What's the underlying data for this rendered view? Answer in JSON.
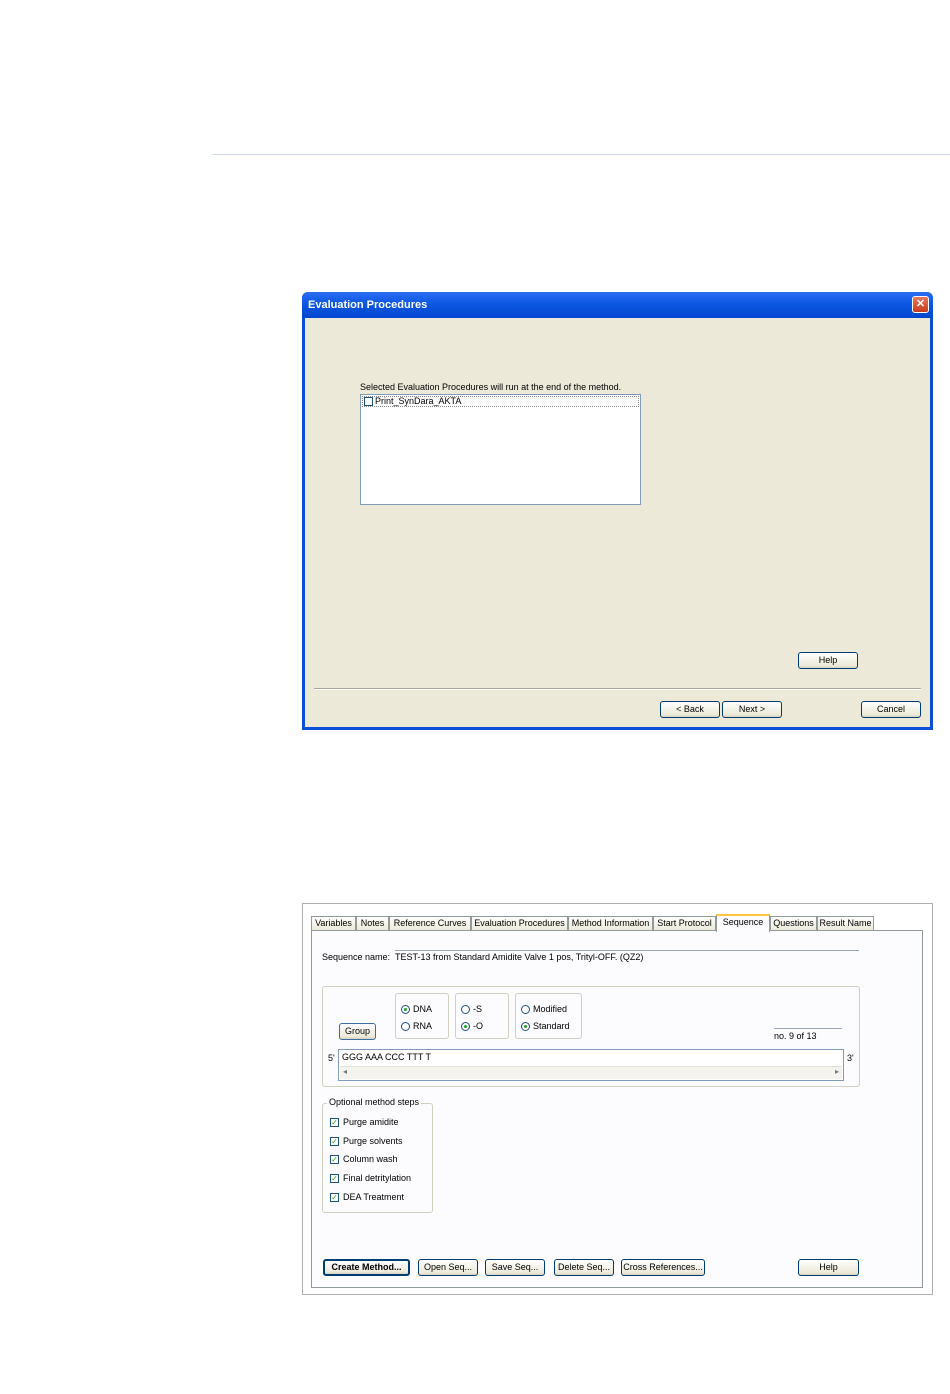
{
  "dialog": {
    "title": "Evaluation Procedures",
    "close_glyph": "✕",
    "instruction": "Selected Evaluation Procedures will run at the end of the method.",
    "procedures": [
      {
        "label": "Print_SynDara_AKTA",
        "checked": false
      }
    ],
    "help_label": "Help",
    "back_label": "< Back",
    "next_label": "Next >",
    "cancel_label": "Cancel"
  },
  "method_editor": {
    "tabs": [
      {
        "label": "Variables",
        "active": false
      },
      {
        "label": "Notes",
        "active": false
      },
      {
        "label": "Reference Curves",
        "active": false
      },
      {
        "label": "Evaluation Procedures",
        "active": false
      },
      {
        "label": "Method Information",
        "active": false
      },
      {
        "label": "Start Protocol",
        "active": false
      },
      {
        "label": "Sequence",
        "active": true
      },
      {
        "label": "Questions",
        "active": false
      },
      {
        "label": "Result Name",
        "active": false
      }
    ],
    "sequence_name_label": "Sequence name:",
    "sequence_name_value": "TEST-13 from Standard Amidite Valve 1 pos, Trityl-OFF. (QZ2)",
    "group_label": "Group",
    "type_options": [
      {
        "label": "DNA",
        "selected": true
      },
      {
        "label": "RNA",
        "selected": false
      }
    ],
    "linkage_options": [
      {
        "label": "-S",
        "selected": false
      },
      {
        "label": "-O",
        "selected": true
      }
    ],
    "chemistry_options": [
      {
        "label": "Modified",
        "selected": false
      },
      {
        "label": "Standard",
        "selected": true
      }
    ],
    "position_text": "no. 9 of 13",
    "five_prime": "5'",
    "three_prime": "3'",
    "sequence": "GGG AAA CCC TTT T",
    "scroll_left": "◂",
    "scroll_right": "▸",
    "optional_steps_title": "Optional method steps",
    "optional_steps": [
      {
        "label": "Purge amidite",
        "checked": true
      },
      {
        "label": "Purge solvents",
        "checked": true
      },
      {
        "label": "Column wash",
        "checked": true
      },
      {
        "label": "Final detritylation",
        "checked": true
      },
      {
        "label": "DEA Treatment",
        "checked": true
      }
    ],
    "check_glyph": "✓",
    "buttons": {
      "create_method": "Create Method...",
      "open_seq": "Open Seq...",
      "save_seq": "Save Seq...",
      "delete_seq": "Delete Seq...",
      "cross_references": "Cross References...",
      "help": "Help"
    }
  }
}
